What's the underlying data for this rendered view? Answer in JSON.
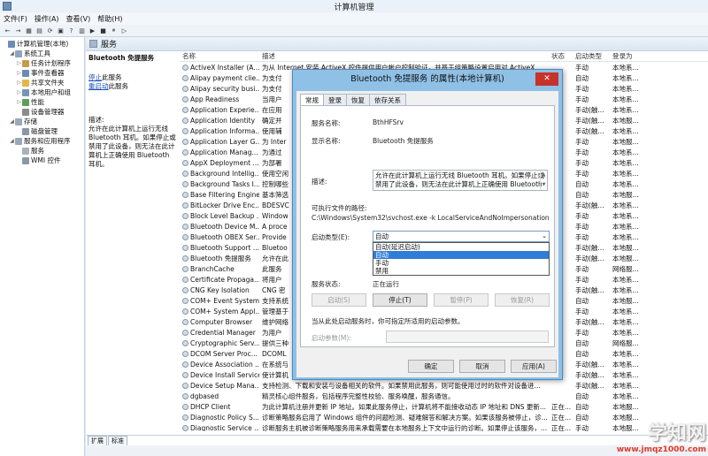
{
  "window": {
    "title": "计算机管理"
  },
  "menu": [
    "文件(F)",
    "操作(A)",
    "查看(V)",
    "帮助(H)"
  ],
  "toolbar": [
    "←",
    "→",
    "▦",
    "▤",
    "⟳",
    "▣",
    "?",
    "▥",
    "▶",
    "■",
    "⏸",
    "▷"
  ],
  "tree": [
    {
      "label": "计算机管理(本地)",
      "level": 0,
      "color": "#6b8db4"
    },
    {
      "label": "系统工具",
      "level": 1,
      "color": "#8ca4bf",
      "exp": "◢"
    },
    {
      "label": "任务计划程序",
      "level": 2,
      "color": "#c69c4a",
      "exp": "▷"
    },
    {
      "label": "事件查看器",
      "level": 2,
      "color": "#6a8cb0",
      "exp": "▷"
    },
    {
      "label": "共享文件夹",
      "level": 2,
      "color": "#e2b84a",
      "exp": "▷"
    },
    {
      "label": "本地用户和组",
      "level": 2,
      "color": "#7a94b3",
      "exp": "▷"
    },
    {
      "label": "性能",
      "level": 2,
      "color": "#5d9e5d",
      "exp": "▷"
    },
    {
      "label": "设备管理器",
      "level": 2,
      "color": "#8b8b8b"
    },
    {
      "label": "存储",
      "level": 1,
      "color": "#9aa8b8",
      "exp": "◢"
    },
    {
      "label": "磁盘管理",
      "level": 2,
      "color": "#8a96a4"
    },
    {
      "label": "服务和应用程序",
      "level": 1,
      "color": "#9aa8b8",
      "exp": "◢"
    },
    {
      "label": "服务",
      "level": 2,
      "color": "#a9b2bc"
    },
    {
      "label": "WMI 控件",
      "level": 2,
      "color": "#8a98a8"
    }
  ],
  "content": {
    "header": "服务",
    "desc_title": "Bluetooth 免提服务",
    "stop_link": "停止",
    "stop_suffix": "此服务",
    "restart_link": "重启动",
    "restart_suffix": "此服务",
    "desc_label": "描述:",
    "desc_text": "允许在此计算机上运行无线 Bluetooth 耳机。如果停止或禁用了此设备，则无法在此计算机上正确使用 Bluetooth 耳机。",
    "tabs": [
      "扩展",
      "标准"
    ]
  },
  "columns": {
    "name": "名称",
    "desc": "描述",
    "status": "状态",
    "start": "启动类型",
    "logon": "登录为"
  },
  "rows": [
    {
      "name": "ActiveX Installer (A...",
      "desc": "为从 Internet 安装 ActiveX 控件提供用户帐户控制验证，并基于组策略设置启用对 ActiveX ...",
      "status": "",
      "start": "手动",
      "logon": "本地系..."
    },
    {
      "name": "Alipay payment clie...",
      "desc": "为支付",
      "status": "",
      "start": "自动",
      "logon": "本地系..."
    },
    {
      "name": "Alipay security busi...",
      "desc": "为支付",
      "status": "",
      "start": "手动",
      "logon": "本地系..."
    },
    {
      "name": "App Readiness",
      "desc": "当用户",
      "status": "",
      "start": "手动",
      "logon": "本地系..."
    },
    {
      "name": "Application Experie...",
      "desc": "在应用",
      "status": "",
      "start": "手动(触...",
      "logon": "本地系..."
    },
    {
      "name": "Application Identity",
      "desc": "确定并",
      "status": "",
      "start": "手动(触...",
      "logon": "本地服..."
    },
    {
      "name": "Application Informa...",
      "desc": "使用辅",
      "status": "",
      "start": "手动(触...",
      "logon": "本地系..."
    },
    {
      "name": "Application Layer G...",
      "desc": "为 Inter",
      "status": "",
      "start": "手动",
      "logon": "本地服..."
    },
    {
      "name": "Application Manag...",
      "desc": "为通过",
      "status": "",
      "start": "手动",
      "logon": "本地系..."
    },
    {
      "name": "AppX Deployment ...",
      "desc": "为部署",
      "status": "",
      "start": "手动",
      "logon": "本地系..."
    },
    {
      "name": "Background Intellig...",
      "desc": "使用空闲",
      "status": "",
      "start": "手动",
      "logon": "本地系..."
    },
    {
      "name": "Background Tasks I...",
      "desc": "控制哪些",
      "status": "",
      "start": "自动",
      "logon": "本地系..."
    },
    {
      "name": "Base Filtering Engine",
      "desc": "基本筛选",
      "status": "",
      "start": "自动",
      "logon": "本地服..."
    },
    {
      "name": "BitLocker Drive Enc...",
      "desc": "BDESVC",
      "status": "",
      "start": "手动(触...",
      "logon": "本地系..."
    },
    {
      "name": "Block Level Backup ...",
      "desc": "Window",
      "status": "",
      "start": "手动",
      "logon": "本地系..."
    },
    {
      "name": "Bluetooth Device M...",
      "desc": "A proce",
      "status": "",
      "start": "手动",
      "logon": "本地系..."
    },
    {
      "name": "Bluetooth OBEX Ser...",
      "desc": "Provide",
      "status": "",
      "start": "手动",
      "logon": "本地系..."
    },
    {
      "name": "Bluetooth Support ...",
      "desc": "Bluetoo",
      "status": "",
      "start": "手动(触...",
      "logon": "本地服..."
    },
    {
      "name": "Bluetooth 免提服务",
      "desc": "允许在此",
      "status": "",
      "start": "手动(触...",
      "logon": "本地服..."
    },
    {
      "name": "BranchCache",
      "desc": "此服务",
      "status": "",
      "start": "手动",
      "logon": "网络服..."
    },
    {
      "name": "Certificate Propaga...",
      "desc": "将用户",
      "status": "",
      "start": "手动",
      "logon": "本地系..."
    },
    {
      "name": "CNG Key Isolation",
      "desc": "CNG 密",
      "status": "",
      "start": "手动(触...",
      "logon": "本地系..."
    },
    {
      "name": "COM+ Event System",
      "desc": "支持系统",
      "status": "",
      "start": "自动",
      "logon": "本地服..."
    },
    {
      "name": "COM+ System Appl...",
      "desc": "管理基于",
      "status": "",
      "start": "手动",
      "logon": "本地系..."
    },
    {
      "name": "Computer Browser",
      "desc": "维护网络",
      "status": "",
      "start": "手动(触...",
      "logon": "本地系..."
    },
    {
      "name": "Credential Manager",
      "desc": "为用户",
      "status": "",
      "start": "手动",
      "logon": "本地系..."
    },
    {
      "name": "Cryptographic Serv...",
      "desc": "提供三种",
      "status": "",
      "start": "自动",
      "logon": "网络服..."
    },
    {
      "name": "DCOM Server Proc...",
      "desc": "DCOML",
      "status": "",
      "start": "自动",
      "logon": "本地系..."
    },
    {
      "name": "Device Association ...",
      "desc": "在系统与",
      "status": "",
      "start": "手动(触...",
      "logon": "本地系..."
    },
    {
      "name": "Device Install Service",
      "desc": "使计算机",
      "status": "",
      "start": "手动(触...",
      "logon": "本地系..."
    },
    {
      "name": "Device Setup Mana...",
      "desc": "支持检测、下载和安装与设备相关的软件。如果禁用此服务，则可能使用过时的软件对设备进...",
      "status": "",
      "start": "手动(触...",
      "logon": "本地系..."
    },
    {
      "name": "dgbased",
      "desc": "精灵核心组件服务，包括程序完整性校验、服务唤醒，服务通信。",
      "status": "",
      "start": "自动",
      "logon": "本地系..."
    },
    {
      "name": "DHCP Client",
      "desc": "为此计算机注册并更新 IP 地址。如果此服务停止，计算机将不能接收动态 IP 地址和 DNS 更新...",
      "status": "正在...",
      "start": "自动",
      "logon": "本地服..."
    },
    {
      "name": "Diagnostic Policy S...",
      "desc": "诊断策略服务启用了 Windows 组件的问题检测、疑难解答和解决方案。如果该服务被停止，诊...",
      "status": "正在...",
      "start": "自动",
      "logon": "本地服..."
    },
    {
      "name": "Diagnostic Service ...",
      "desc": "诊断服务主机被诊断策略服务用来承载需要在本地服务上下文中运行的诊断。如果停止该服务，...",
      "status": "正在...",
      "start": "手动",
      "logon": "本地服..."
    }
  ],
  "dialog": {
    "title": "Bluetooth 免提服务 的属性(本地计算机)",
    "tabs": [
      "常规",
      "登录",
      "恢复",
      "依存关系"
    ],
    "service_name_label": "服务名称:",
    "service_name": "BthHFSrv",
    "display_name_label": "显示名称:",
    "display_name": "Bluetooth 免提服务",
    "desc_label": "描述:",
    "desc": "允许在此计算机上运行无线 Bluetooth 耳机。如果停止或禁用了此设备，则无法在此计算机上正确使用 Bluetooth 耳机。",
    "path_label": "可执行文件的路径:",
    "path": "C:\\Windows\\System32\\svchost.exe -k LocalServiceAndNoImpersonation",
    "startup_label": "启动类型(E):",
    "startup_value": "自动",
    "startup_options": [
      "自动(延迟启动)",
      "自动",
      "手动",
      "禁用"
    ],
    "startup_selected_index": 1,
    "status_label": "服务状态:",
    "status_value": "正在运行",
    "btn_start": "启动(S)",
    "btn_stop": "停止(T)",
    "btn_pause": "暂停(P)",
    "btn_resume": "恢复(R)",
    "hint": "当从此处启动服务时，你可指定所适用的启动参数。",
    "param_label": "启动参数(M):",
    "ok": "确定",
    "cancel": "取消",
    "apply": "应用(A)"
  },
  "watermark": {
    "big": "学知网",
    "small": "www.jmqz1000.com"
  }
}
